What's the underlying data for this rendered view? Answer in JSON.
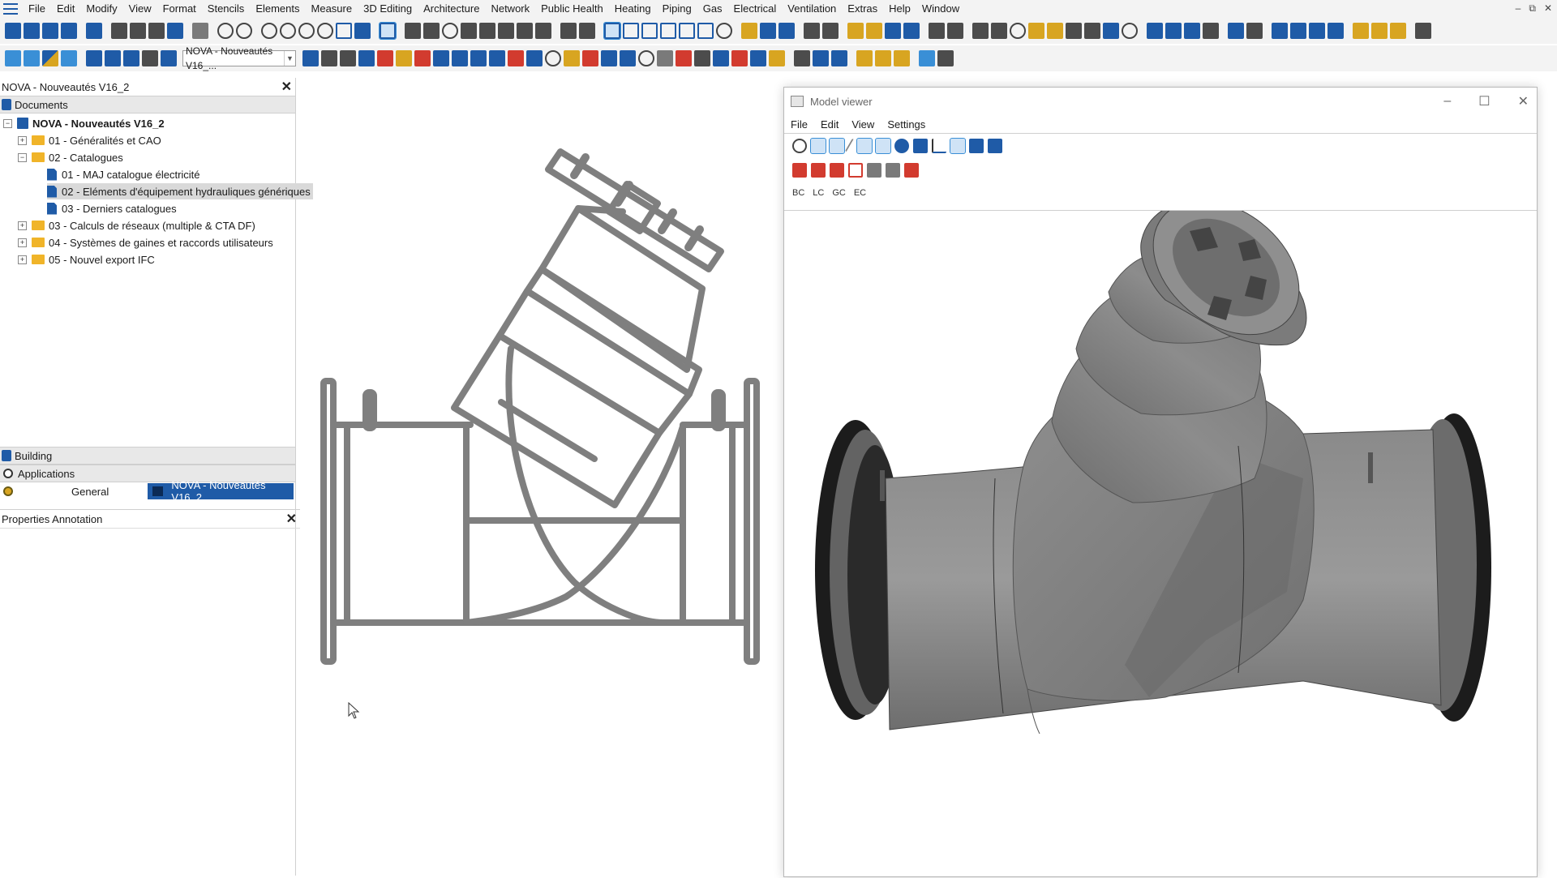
{
  "menu": {
    "items": [
      "File",
      "Edit",
      "Modify",
      "View",
      "Format",
      "Stencils",
      "Elements",
      "Measure",
      "3D Editing",
      "Architecture",
      "Network",
      "Public Health",
      "Heating",
      "Piping",
      "Gas",
      "Electrical",
      "Ventilation",
      "Extras",
      "Help",
      "Window"
    ]
  },
  "toolbar": {
    "document_select": "NOVA - Nouveautés V16_..."
  },
  "documents_panel": {
    "title": "NOVA - Nouveautés V16_2",
    "section": "Documents",
    "tree": {
      "root": "NOVA - Nouveautés V16_2",
      "item1": "01 - Généralités et CAO",
      "item2": "02 - Catalogues",
      "item2_1": "01 - MAJ catalogue électricité",
      "item2_2": "02 - Eléments d'équipement hydrauliques génériques",
      "item2_3": "03 - Derniers catalogues",
      "item3": "03 - Calculs de réseaux (multiple & CTA DF)",
      "item4": "04 - Systèmes de gaines et raccords utilisateurs",
      "item5": "05 - Nouvel export IFC"
    },
    "building": "Building",
    "applications": "Applications",
    "general": "General",
    "app_active": "NOVA - Nouveautés V16_2",
    "properties": "Properties Annotation"
  },
  "model_viewer": {
    "title": "Model viewer",
    "menu": [
      "File",
      "Edit",
      "View",
      "Settings"
    ],
    "toolbar3": [
      "BC",
      "LC",
      "GC",
      "EC"
    ]
  },
  "colors": {
    "accent": "#1f5ba7",
    "drawing_stroke": "#7f7f7f",
    "model_gray": "#7d7d7d"
  }
}
